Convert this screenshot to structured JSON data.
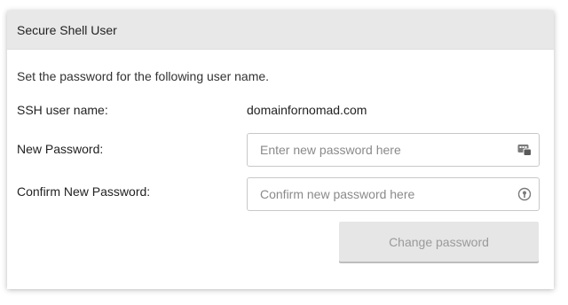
{
  "panel": {
    "title": "Secure Shell User",
    "intro": "Set the password for the following user name."
  },
  "form": {
    "username_label": "SSH user name:",
    "username_value": "domainfornomad.com",
    "new_password_label": "New Password:",
    "new_password_placeholder": "Enter new password here",
    "new_password_icon": "password-manager-icon",
    "confirm_password_label": "Confirm New Password:",
    "confirm_password_placeholder": "Confirm new password here",
    "confirm_password_icon": "key-icon",
    "submit_label": "Change password",
    "submit_disabled": true
  }
}
